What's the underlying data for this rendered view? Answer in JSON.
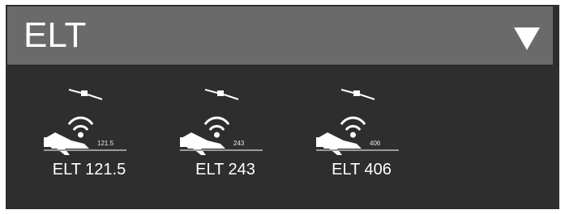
{
  "header": {
    "title": "ELT",
    "dropdown_icon": "chevron-down-icon"
  },
  "items": [
    {
      "label": "ELT 121.5",
      "freq": "121.5",
      "icon": "elt-satellite-plane-icon"
    },
    {
      "label": "ELT 243",
      "freq": "243",
      "icon": "elt-satellite-plane-icon"
    },
    {
      "label": "ELT 406",
      "freq": "406",
      "icon": "elt-satellite-plane-icon"
    }
  ],
  "colors": {
    "panel_bg": "#2e2e2e",
    "header_bg": "#6b6a6b",
    "text": "#ffffff"
  }
}
